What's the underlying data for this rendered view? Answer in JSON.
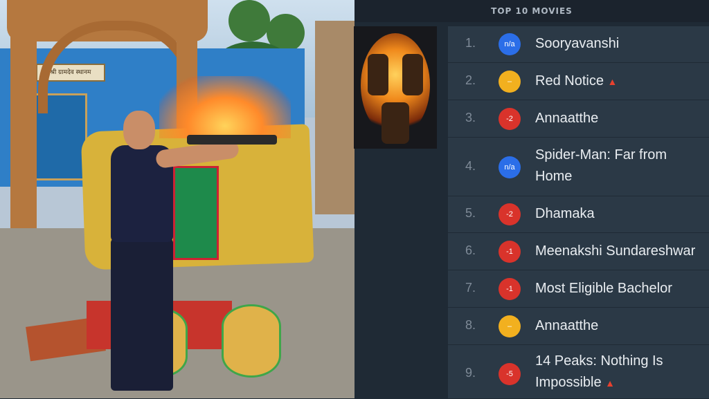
{
  "panel_title": "TOP 10 MOVIES",
  "photo": {
    "sign_text": "श्री ग्रामदेव स्थानम"
  },
  "movies": [
    {
      "rank": "1.",
      "badge": "n/a",
      "badge_type": "new",
      "title": "Sooryavanshi",
      "icon": ""
    },
    {
      "rank": "2.",
      "badge": "–",
      "badge_type": "same",
      "title": "Red Notice",
      "icon": "fire-icon"
    },
    {
      "rank": "3.",
      "badge": "-2",
      "badge_type": "down",
      "title": "Annaatthe",
      "icon": ""
    },
    {
      "rank": "4.",
      "badge": "n/a",
      "badge_type": "new",
      "title": "Spider-Man: Far from Home",
      "icon": ""
    },
    {
      "rank": "5.",
      "badge": "-2",
      "badge_type": "down",
      "title": "Dhamaka",
      "icon": ""
    },
    {
      "rank": "6.",
      "badge": "-1",
      "badge_type": "down",
      "title": "Meenakshi Sundareshwar",
      "icon": ""
    },
    {
      "rank": "7.",
      "badge": "-1",
      "badge_type": "down",
      "title": "Most Eligible Bachelor",
      "icon": ""
    },
    {
      "rank": "8.",
      "badge": "–",
      "badge_type": "same",
      "title": "Annaatthe",
      "icon": ""
    },
    {
      "rank": "9.",
      "badge": "-5",
      "badge_type": "down",
      "title": "14 Peaks: Nothing Is Impossible",
      "icon": "fire-icon"
    }
  ],
  "colors": {
    "panel_bg": "#1f2a35",
    "row_bg": "#2b3946",
    "badge_new": "#2b6ee8",
    "badge_down": "#d9332b",
    "badge_same": "#f2b01f"
  }
}
